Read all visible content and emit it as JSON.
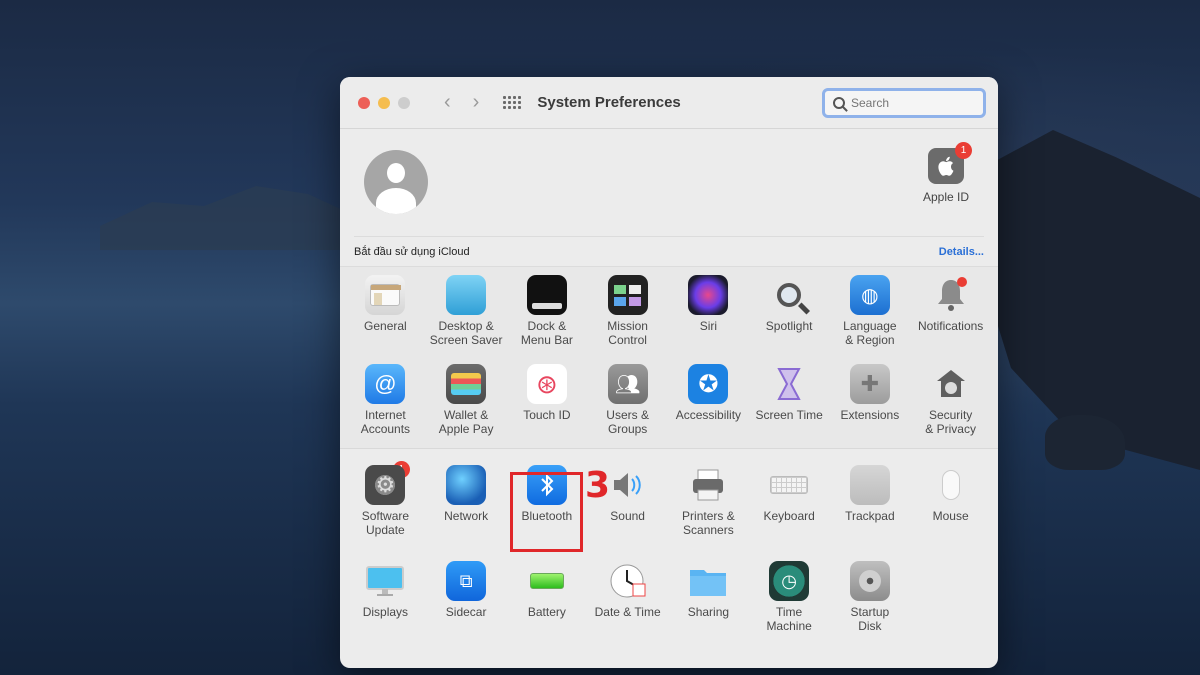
{
  "window": {
    "title": "System Preferences"
  },
  "search": {
    "placeholder": "Search"
  },
  "account": {
    "icloud_text": "Bắt đầu sử dụng iCloud",
    "details_label": "Details...",
    "apple_id_label": "Apple ID",
    "apple_id_badge": "1"
  },
  "section1": [
    {
      "label": "General",
      "icon": "general-icon"
    },
    {
      "label": "Desktop &\nScreen Saver",
      "icon": "desktop-icon"
    },
    {
      "label": "Dock &\nMenu Bar",
      "icon": "dock-icon"
    },
    {
      "label": "Mission\nControl",
      "icon": "mission-control-icon"
    },
    {
      "label": "Siri",
      "icon": "siri-icon"
    },
    {
      "label": "Spotlight",
      "icon": "spotlight-icon"
    },
    {
      "label": "Language\n& Region",
      "icon": "language-icon"
    },
    {
      "label": "Notifications",
      "icon": "notifications-icon"
    },
    {
      "label": "Internet\nAccounts",
      "icon": "internet-accounts-icon"
    },
    {
      "label": "Wallet &\nApple Pay",
      "icon": "wallet-icon"
    },
    {
      "label": "Touch ID",
      "icon": "touch-id-icon"
    },
    {
      "label": "Users &\nGroups",
      "icon": "users-icon"
    },
    {
      "label": "Accessibility",
      "icon": "accessibility-icon"
    },
    {
      "label": "Screen Time",
      "icon": "screen-time-icon"
    },
    {
      "label": "Extensions",
      "icon": "extensions-icon"
    },
    {
      "label": "Security\n& Privacy",
      "icon": "security-icon"
    }
  ],
  "section2": [
    {
      "label": "Software\nUpdate",
      "icon": "software-update-icon",
      "badge": "1"
    },
    {
      "label": "Network",
      "icon": "network-icon"
    },
    {
      "label": "Bluetooth",
      "icon": "bluetooth-icon"
    },
    {
      "label": "Sound",
      "icon": "sound-icon"
    },
    {
      "label": "Printers &\nScanners",
      "icon": "printers-icon"
    },
    {
      "label": "Keyboard",
      "icon": "keyboard-icon"
    },
    {
      "label": "Trackpad",
      "icon": "trackpad-icon"
    },
    {
      "label": "Mouse",
      "icon": "mouse-icon"
    },
    {
      "label": "Displays",
      "icon": "displays-icon"
    },
    {
      "label": "Sidecar",
      "icon": "sidecar-icon"
    },
    {
      "label": "Battery",
      "icon": "battery-icon"
    },
    {
      "label": "Date & Time",
      "icon": "date-time-icon"
    },
    {
      "label": "Sharing",
      "icon": "sharing-icon"
    },
    {
      "label": "Time\nMachine",
      "icon": "time-machine-icon"
    },
    {
      "label": "Startup\nDisk",
      "icon": "startup-disk-icon"
    }
  ],
  "annotation": {
    "step_number": "3"
  },
  "colors": {
    "highlight": "#e0272a",
    "accent": "#2a6fd6",
    "badge": "#ea3d34"
  }
}
